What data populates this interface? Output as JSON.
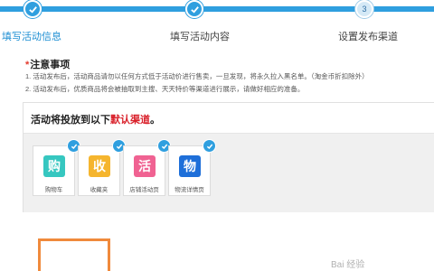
{
  "progress": {
    "steps": [
      {
        "label": "填写活动信息",
        "state": "done",
        "icon": "check-icon"
      },
      {
        "label": "填写活动内容",
        "state": "done",
        "icon": "check-icon"
      },
      {
        "label": "设置发布渠道",
        "state": "current",
        "number": "3"
      }
    ],
    "accent": "#2f9fdf"
  },
  "notes": {
    "star": "*",
    "title": "注意事项",
    "lines": [
      "1.  活动发布后，活动商品请勿以任何方式低于活动价进行售卖，一旦发现，将永久拉入黑名单。（淘金币折扣除外）",
      "2.  活动发布后，优质商品将会被抽取到主搜、天天特价等渠道进行展示，请做好相应的准备。"
    ]
  },
  "channels": {
    "title_prefix": "活动将投放到以下",
    "title_highlight": "默认渠道",
    "title_suffix": "。",
    "highlight_color": "#d9202a",
    "cards": [
      {
        "icon_char": "购",
        "icon_name": "cart-icon",
        "color": "#36c7c0",
        "label": "购物车"
      },
      {
        "icon_char": "收",
        "icon_name": "favorites-icon",
        "color": "#f5b52e",
        "label": "收藏夹"
      },
      {
        "icon_char": "活",
        "icon_name": "shop-activity-icon",
        "color": "#f06292",
        "label": "店铺活动页"
      },
      {
        "icon_char": "物",
        "icon_name": "logistics-detail-icon",
        "color": "#1e6fd9",
        "label": "物流详情页"
      }
    ]
  },
  "watermark": "Bai 经验"
}
